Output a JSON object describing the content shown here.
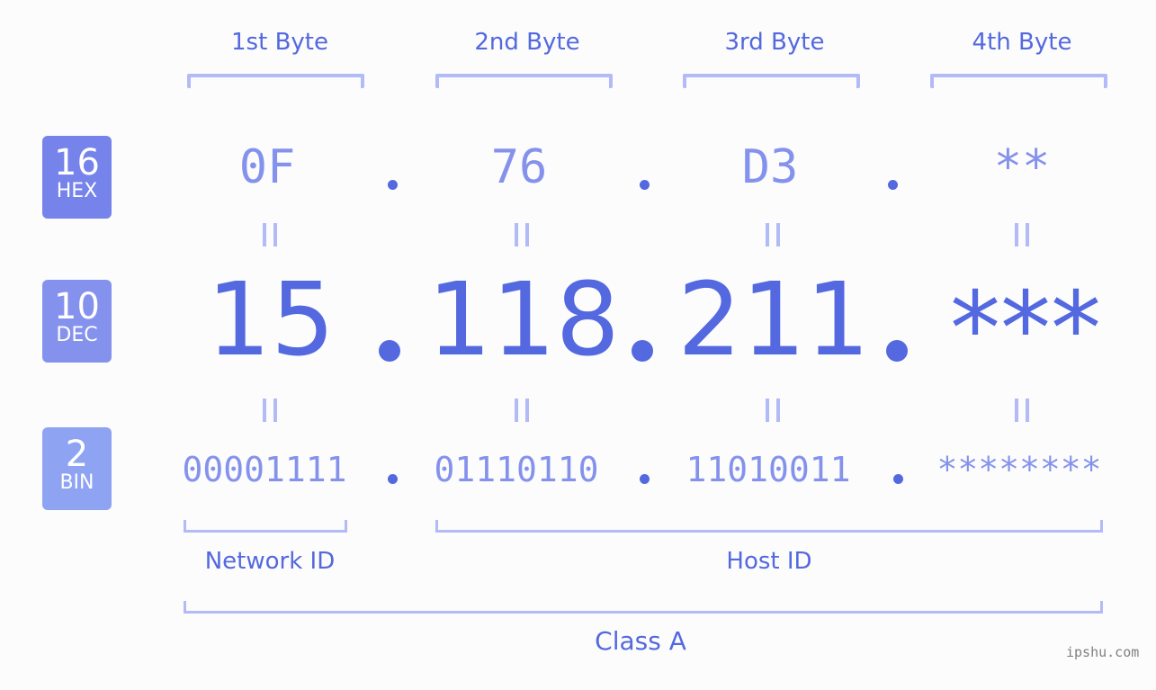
{
  "bytes": [
    {
      "label": "1st Byte",
      "hex": "0F",
      "dec": "15",
      "bin": "00001111"
    },
    {
      "label": "2nd Byte",
      "hex": "76",
      "dec": "118",
      "bin": "01110110"
    },
    {
      "label": "3rd Byte",
      "hex": "D3",
      "dec": "211",
      "bin": "11010011"
    },
    {
      "label": "4th Byte",
      "hex": "**",
      "dec": "***",
      "bin": "********"
    }
  ],
  "badges": {
    "hex": {
      "base": "16",
      "name": "HEX",
      "color": "#7583eb"
    },
    "dec": {
      "base": "10",
      "name": "DEC",
      "color": "#8592ed"
    },
    "bin": {
      "base": "2",
      "name": "BIN",
      "color": "#8fa3f3"
    }
  },
  "segments": {
    "network": "Network ID",
    "host": "Host ID",
    "class": "Class A"
  },
  "watermark": "ipshu.com",
  "colors": {
    "accent": "#5468e0",
    "light": "#8592ed",
    "bracket": "#b2bbf7"
  }
}
